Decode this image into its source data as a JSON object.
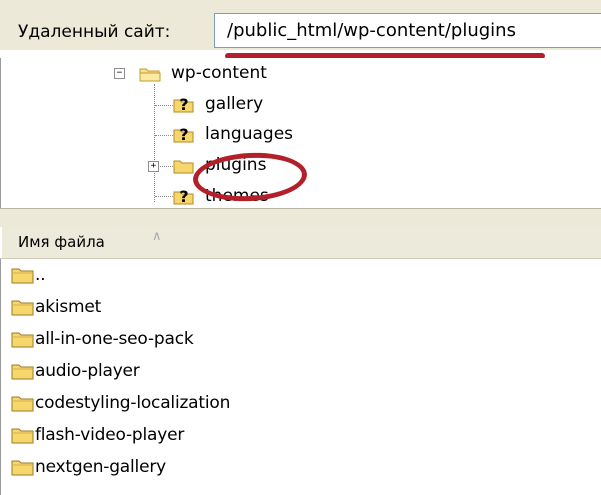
{
  "remote_site": {
    "label": "Удаленный сайт:",
    "path": "/public_html/wp-content/plugins"
  },
  "tree": {
    "items": [
      {
        "label": "wp-content",
        "icon": "folder-open-icon",
        "expander": "−"
      },
      {
        "label": "gallery",
        "icon": "folder-unknown-icon"
      },
      {
        "label": "languages",
        "icon": "folder-unknown-icon"
      },
      {
        "label": "plugins",
        "icon": "folder-icon",
        "expander": "+"
      },
      {
        "label": "themes",
        "icon": "folder-unknown-icon"
      }
    ]
  },
  "file_list": {
    "column_header": "Имя файла",
    "sort_indicator": "∧",
    "items": [
      "..",
      "akismet",
      "all-in-one-seo-pack",
      "audio-player",
      "codestyling-localization",
      "flash-video-player",
      "nextgen-gallery"
    ]
  },
  "colors": {
    "annotation_red": "#b3202a",
    "folder_yellow": "#f5d76e",
    "chrome": "#ece9d8"
  }
}
